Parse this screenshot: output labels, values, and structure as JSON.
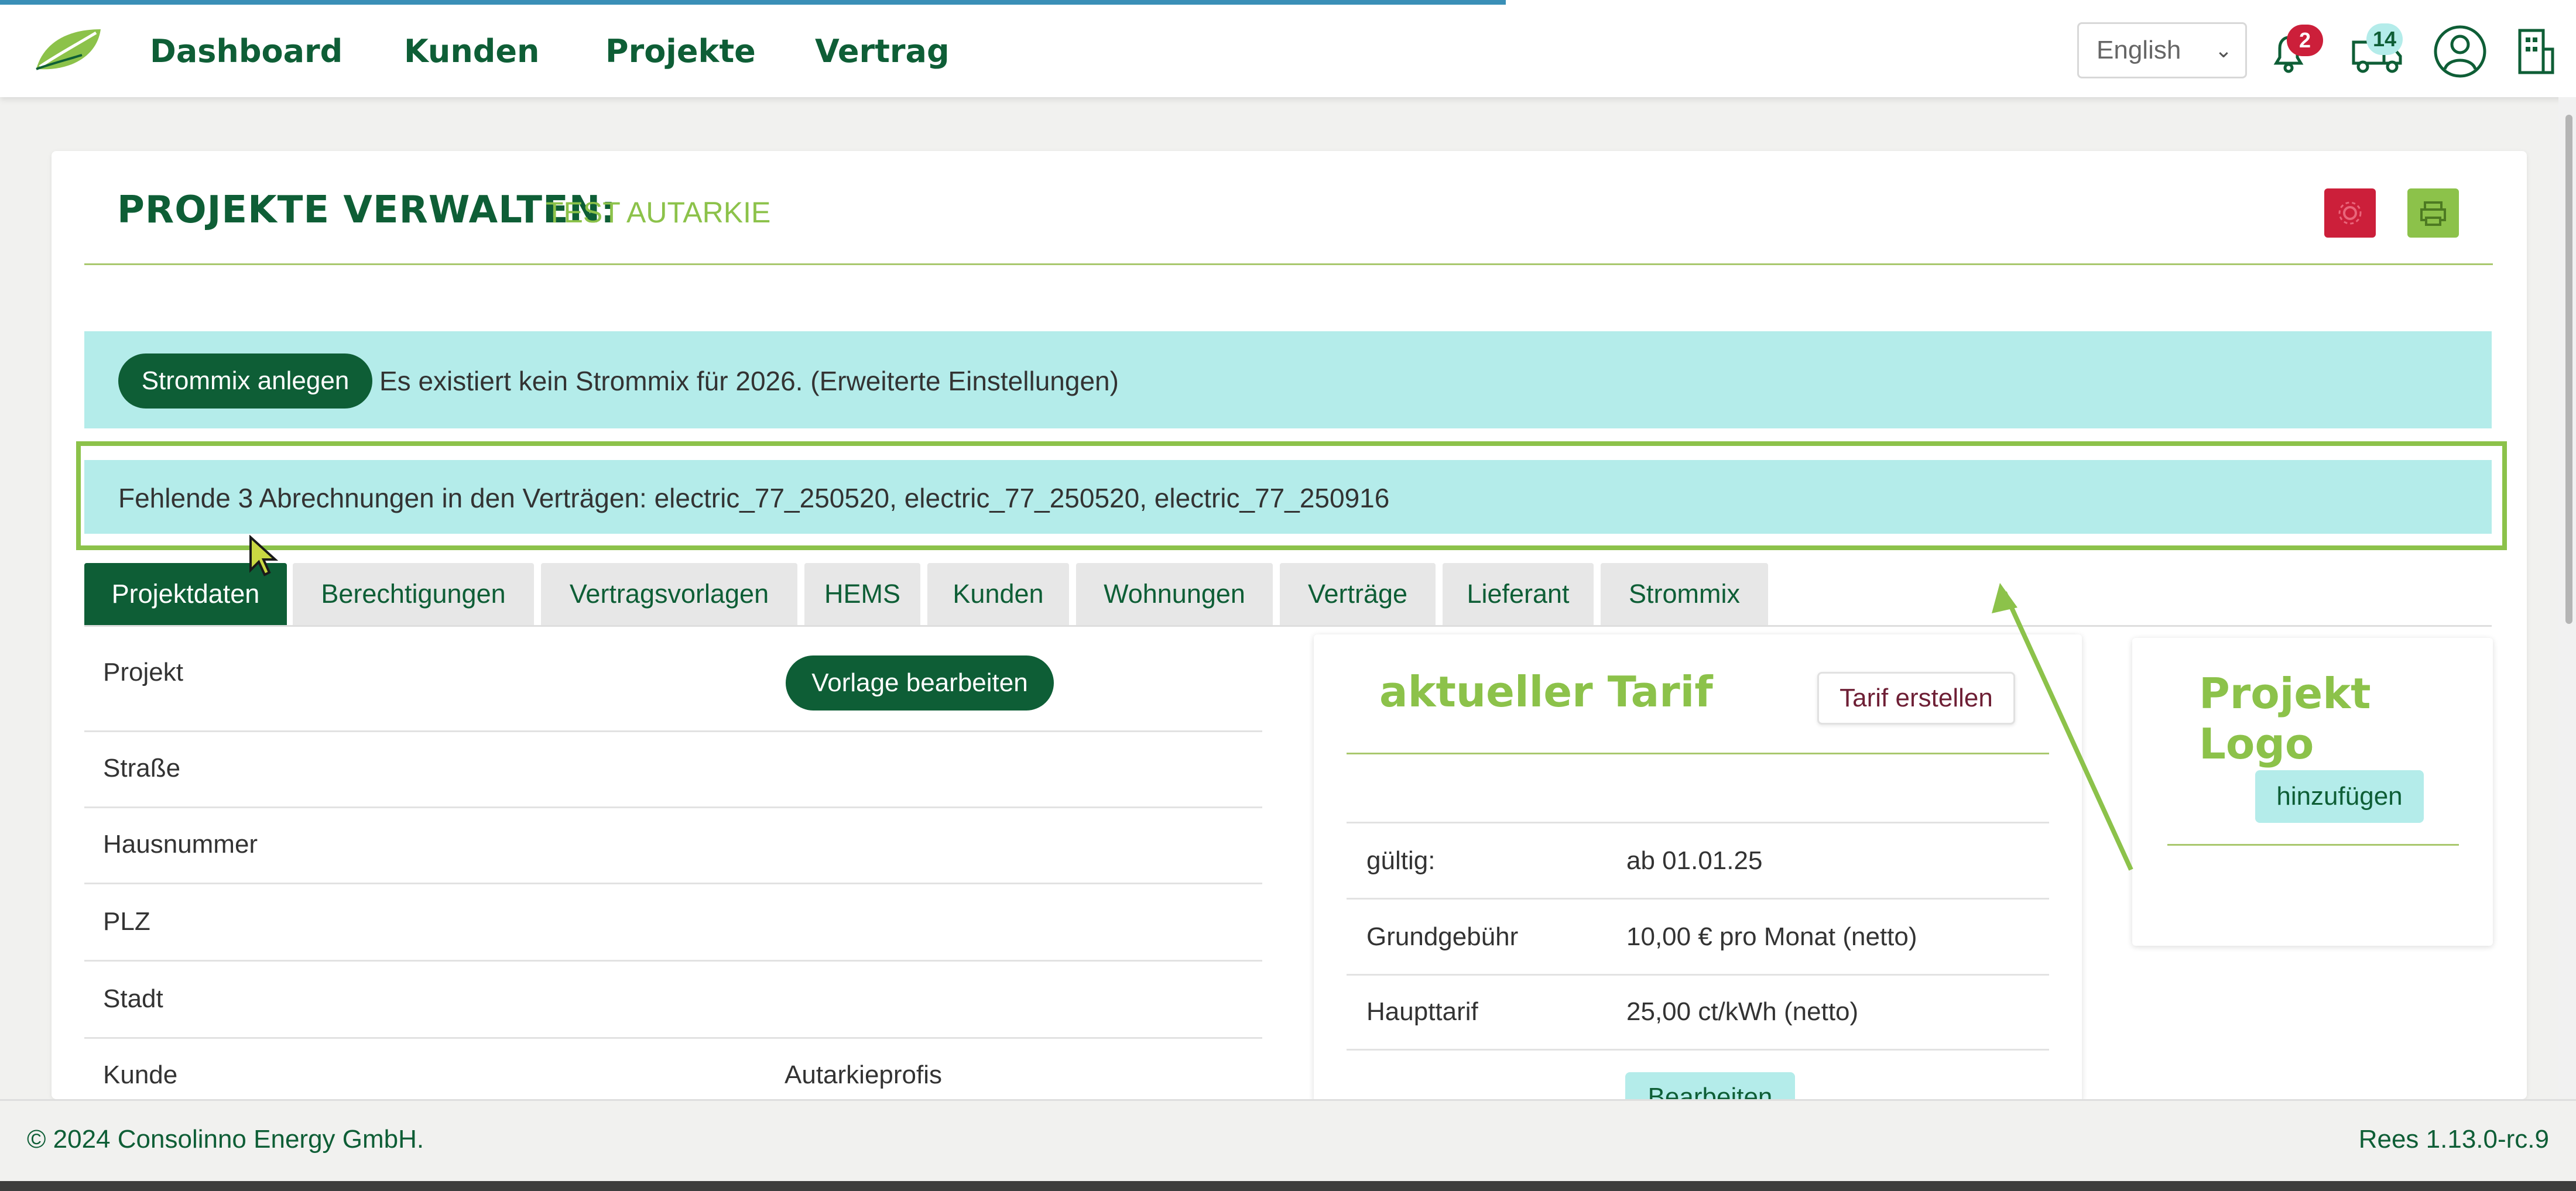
{
  "nav": {
    "items": [
      "Dashboard",
      "Kunden",
      "Projekte",
      "Vertrag"
    ],
    "language": "English",
    "notifications_count": "2",
    "messages_count": "14"
  },
  "page": {
    "title": "PROJEKTE VERWALTEN:",
    "subtitle": "TEST AUTARKIE"
  },
  "alerts": {
    "strommix_button": "Strommix anlegen",
    "strommix_text": "Es existiert kein Strommix für 2026. (Erweiterte Einstellungen)",
    "missing_billing": "Fehlende 3 Abrechnungen in den Verträgen: electric_77_250520, electric_77_250520, electric_77_250916"
  },
  "tabs": [
    "Projektdaten",
    "Berechtigungen",
    "Vertragsvorlagen",
    "HEMS",
    "Kunden",
    "Wohnungen",
    "Verträge",
    "Lieferant",
    "Strommix"
  ],
  "project": {
    "edit_template_button": "Vorlage bearbeiten",
    "rows": [
      {
        "label": "Projekt",
        "value": ""
      },
      {
        "label": "Straße",
        "value": ""
      },
      {
        "label": "Hausnummer",
        "value": ""
      },
      {
        "label": "PLZ",
        "value": ""
      },
      {
        "label": "Stadt",
        "value": ""
      },
      {
        "label": "Kunde",
        "value": "Autarkieprofis"
      }
    ]
  },
  "tariff": {
    "title": "aktueller Tarif",
    "create_button": "Tarif erstellen",
    "rows": [
      {
        "label": "gültig:",
        "value": "ab 01.01.25"
      },
      {
        "label": "Grundgebühr",
        "value": "10,00 € pro Monat (netto)"
      },
      {
        "label": "Haupttarif",
        "value": "25,00 ct/kWh (netto)"
      }
    ],
    "edit_button": "Bearbeiten"
  },
  "logo_panel": {
    "title": "Projekt Logo",
    "add_button": "hinzufügen"
  },
  "footer": {
    "copyright": "© 2024 Consolinno Energy GmbH.",
    "version": "Rees 1.13.0-rc.9"
  },
  "colors": {
    "brand_dark": "#0e5e36",
    "brand_light": "#8cc24a",
    "alert_bg": "#b4ecea",
    "danger": "#cc1f3a",
    "annotation": "#8cc24a"
  },
  "icons": [
    "leaf-logo-icon",
    "bell-icon",
    "truck-icon",
    "user-icon",
    "building-icon",
    "settings-icon",
    "print-icon",
    "chevron-down-icon"
  ]
}
